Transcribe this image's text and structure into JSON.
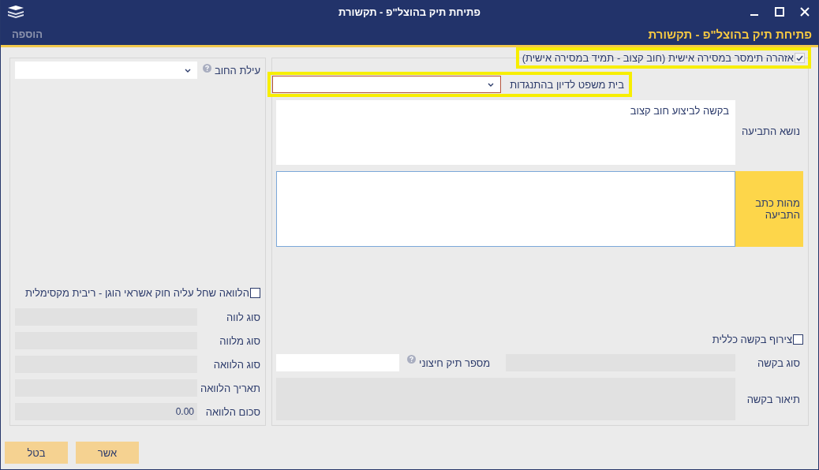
{
  "window": {
    "title": "פתיחת תיק בהוצל\"פ - תקשורת"
  },
  "header": {
    "title": "פתיחת תיק בהוצל\"פ - תקשורת",
    "action": "הוספה"
  },
  "warning": {
    "label": "אזהרה תימסר במסירה אישית (חוב קצוב - תמיד במסירה אישית)",
    "checked": true,
    "highlighted": true
  },
  "court": {
    "label": "בית משפט לדיון בהתנגדות",
    "highlighted": true
  },
  "claim_subject": {
    "label": "נושא התביעה",
    "value": "בקשה לביצוע חוב קצוב"
  },
  "claim_nature": {
    "label": "מהות כתב התביעה",
    "focused": true
  },
  "general_request": {
    "label": "צירוף בקשה כללית",
    "checked": false
  },
  "request_type": {
    "label": "סוג בקשה"
  },
  "external_file": {
    "label": "מספר תיק חיצוני"
  },
  "request_description": {
    "label": "תיאור בקשה"
  },
  "debt_cause": {
    "label": "עילת החוב"
  },
  "credit_law": {
    "label": "הלוואה שחל עליה חוק אשראי הוגן - ריבית מקסימלית",
    "checked": false
  },
  "loan_fields": [
    {
      "label": "סוג לווה"
    },
    {
      "label": "סוג מלווה"
    },
    {
      "label": "סוג הלוואה"
    },
    {
      "label": "תאריך הלוואה"
    },
    {
      "label": "סכום הלוואה",
      "value": "0.00"
    }
  ],
  "buttons": [
    {
      "label": "אשר"
    },
    {
      "label": "בטל"
    }
  ]
}
